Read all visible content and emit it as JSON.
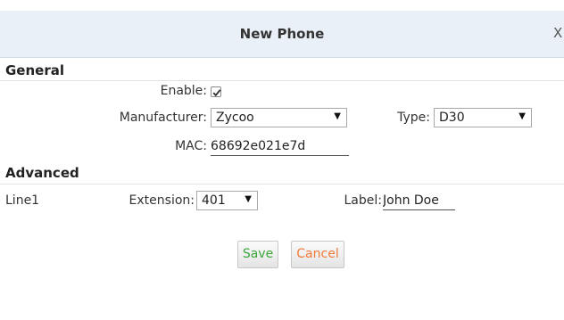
{
  "dialog": {
    "title": "New Phone",
    "close_label": "X"
  },
  "general": {
    "heading": "General",
    "enable": {
      "label": "Enable:",
      "checked": true
    },
    "manufacturer": {
      "label": "Manufacturer:",
      "value": "Zycoo"
    },
    "type": {
      "label": "Type:",
      "value": "D30"
    },
    "mac": {
      "label": "MAC:",
      "value": "68692e021e7d"
    }
  },
  "advanced": {
    "heading": "Advanced",
    "line": "Line1",
    "extension": {
      "label": "Extension:",
      "value": "401"
    },
    "label_field": {
      "label": "Label:",
      "value": "John Doe"
    }
  },
  "buttons": {
    "save": {
      "label": "Save",
      "color": "#3aa63a"
    },
    "cancel": {
      "label": "Cancel",
      "color": "#f07a3a"
    }
  }
}
